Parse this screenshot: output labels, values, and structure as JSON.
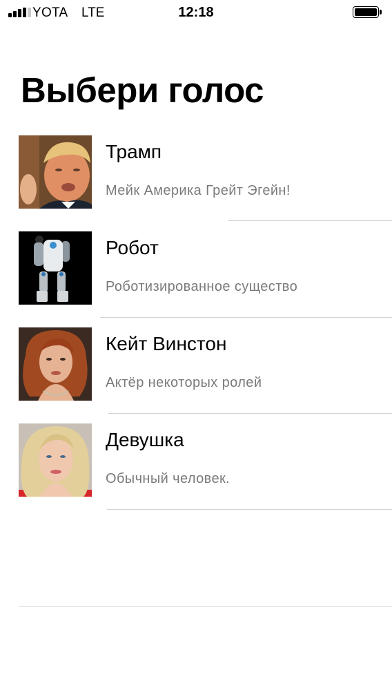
{
  "status_bar": {
    "carrier": "YOTA",
    "network": "LTE",
    "time": "12:18"
  },
  "title": "Выбери голос",
  "voices": [
    {
      "name": "Трамп",
      "description": "Мейк Америка Грейт Эгейн!"
    },
    {
      "name": "Робот",
      "description": "Роботизированное существо"
    },
    {
      "name": "Кейт Винстон",
      "description": "Актёр некоторых ролей"
    },
    {
      "name": "Девушка",
      "description": "Обычный человек."
    }
  ],
  "icons": [
    "signal-icon",
    "battery-icon"
  ]
}
